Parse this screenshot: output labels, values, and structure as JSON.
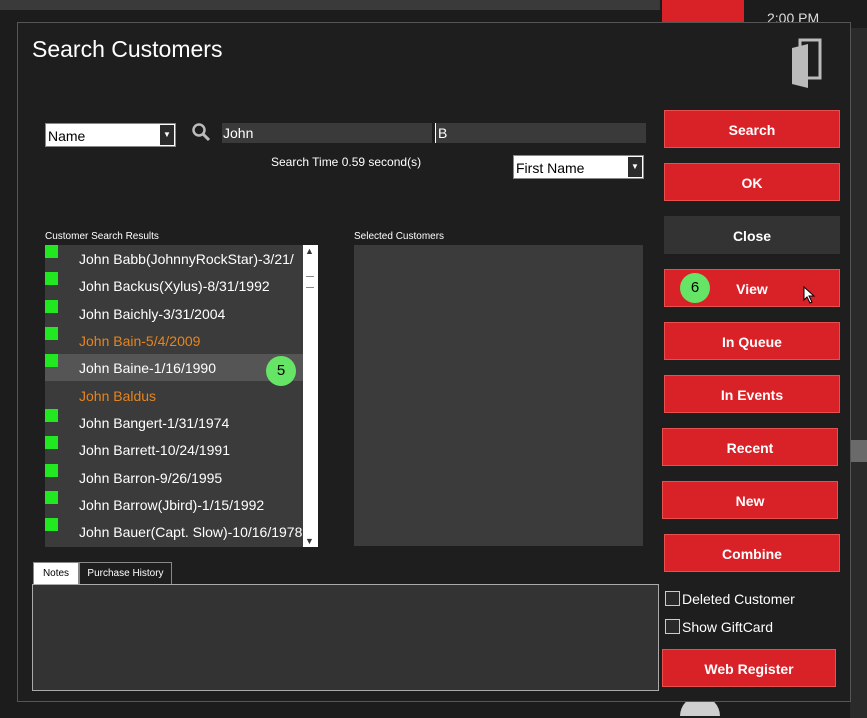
{
  "background": {
    "clock": "2:00 PM"
  },
  "dialog": {
    "title": "Search Customers",
    "search": {
      "field_select": "Name",
      "first_value": "John",
      "last_value": "B",
      "search_time": "Search Time 0.59 second(s)",
      "sort_select": "First Name"
    },
    "results_label": "Customer Search Results",
    "selected_label": "Selected Customers",
    "results": [
      {
        "name": "John  Babb(JohnnyRockStar)-3/21/",
        "marked": true,
        "orange": false,
        "selected": false
      },
      {
        "name": "John Backus(Xylus)-8/31/1992",
        "marked": true,
        "orange": false,
        "selected": false
      },
      {
        "name": "John Baichly-3/31/2004",
        "marked": true,
        "orange": false,
        "selected": false
      },
      {
        "name": "John Bain-5/4/2009",
        "marked": true,
        "orange": true,
        "selected": false
      },
      {
        "name": "John Baine-1/16/1990",
        "marked": false,
        "orange": false,
        "selected": true
      },
      {
        "name": "John Baldus",
        "marked": true,
        "orange": true,
        "selected": false
      },
      {
        "name": "John  Bangert-1/31/1974",
        "marked": true,
        "orange": false,
        "selected": false
      },
      {
        "name": "John Barrett-10/24/1991",
        "marked": true,
        "orange": false,
        "selected": false
      },
      {
        "name": "John Barron-9/26/1995",
        "marked": true,
        "orange": false,
        "selected": false
      },
      {
        "name": "John Barrow(Jbird)-1/15/1992",
        "marked": true,
        "orange": false,
        "selected": false
      },
      {
        "name": "John Bauer(Capt. Slow)-10/16/1978",
        "marked": false,
        "orange": false,
        "selected": false
      }
    ],
    "badges": {
      "results": "5",
      "view": "6"
    },
    "tabs": [
      "Notes",
      "Purchase History"
    ],
    "buttons": {
      "search": "Search",
      "ok": "OK",
      "close": "Close",
      "view": "View",
      "in_queue": "In Queue",
      "in_events": "In Events",
      "recent": "Recent",
      "new": "New",
      "combine": "Combine",
      "web_register": "Web Register"
    },
    "checkboxes": {
      "deleted_customer": "Deleted Customer",
      "show_giftcard": "Show GiftCard"
    }
  },
  "colors": {
    "accent_red": "#d92128",
    "marker_green": "#21e821",
    "highlight_orange": "#e5851e",
    "badge_green": "#66e466"
  }
}
